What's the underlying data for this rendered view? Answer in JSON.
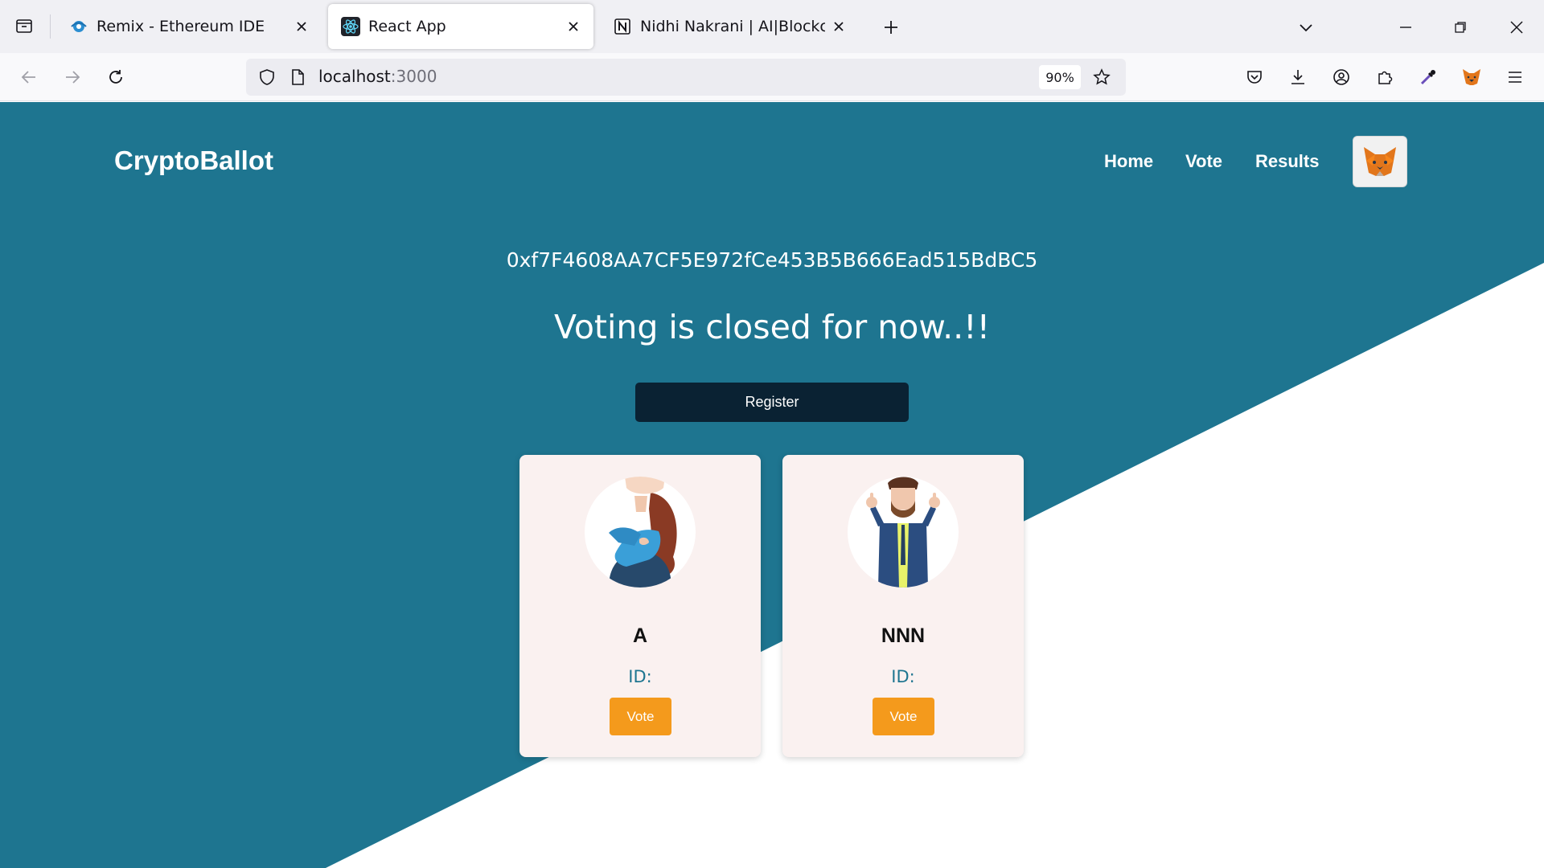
{
  "browser": {
    "tabs": [
      {
        "title": "Remix - Ethereum IDE",
        "favicon": "remix-icon",
        "active": false
      },
      {
        "title": "React App",
        "favicon": "react-icon",
        "active": true
      },
      {
        "title": "Nidhi Nakrani | AI|Blockchain +",
        "favicon": "notion-icon",
        "active": false
      }
    ],
    "url_host": "localhost",
    "url_port": ":3000",
    "zoom": "90%"
  },
  "app": {
    "brand": "CryptoBallot",
    "nav": [
      "Home",
      "Vote",
      "Results"
    ],
    "wallet_icon": "metamask-fox-icon",
    "account_address": "0xf7F4608AA7CF5E972fCe453B5B666Ead515BdBC5",
    "status_message": "Voting is closed for now..!!",
    "register_label": "Register",
    "candidates": [
      {
        "name": "A",
        "id_label": "ID:",
        "vote_label": "Vote",
        "avatar": "woman-arms-crossed-avatar"
      },
      {
        "name": "NNN",
        "id_label": "ID:",
        "vote_label": "Vote",
        "avatar": "bearded-man-thumbs-up-avatar"
      }
    ]
  },
  "colors": {
    "page_teal": "#1e7590",
    "register_bg": "#0a2233",
    "vote_orange": "#f49a1c",
    "card_bg": "#faf1f0"
  }
}
